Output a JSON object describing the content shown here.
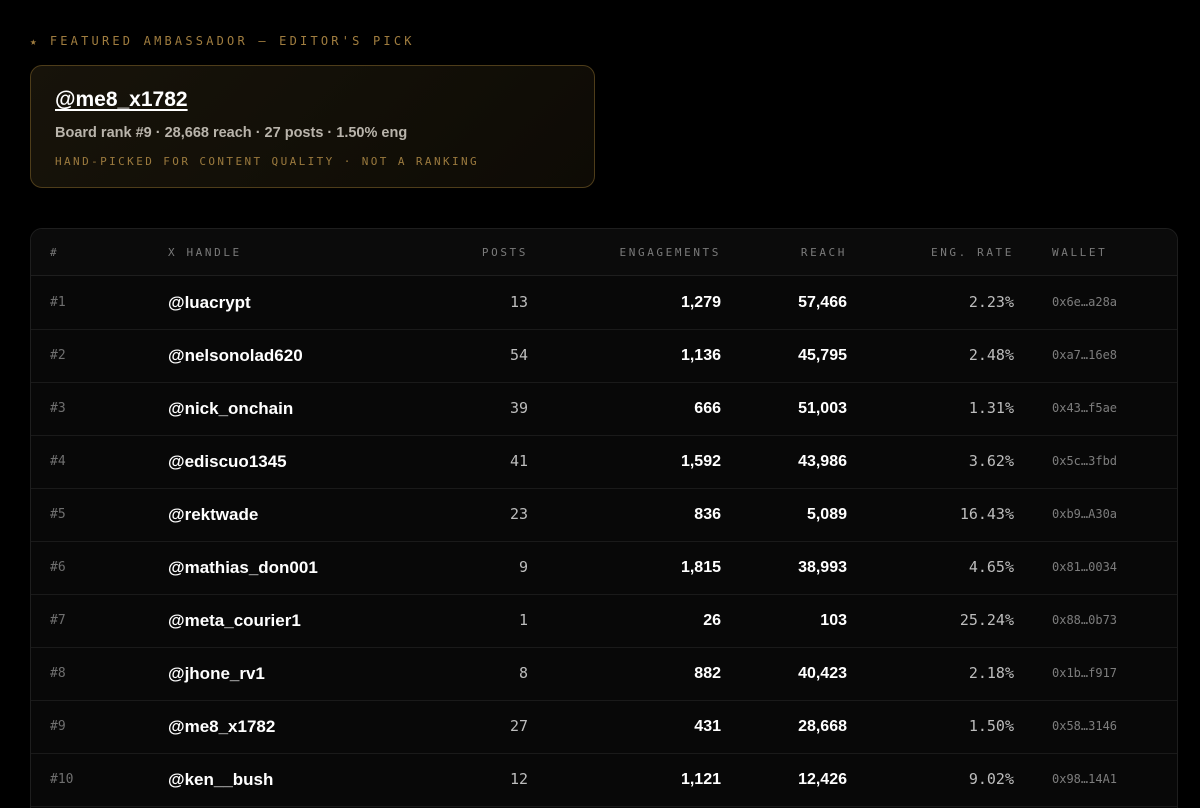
{
  "featured": {
    "star": "★",
    "kicker": "FEATURED AMBASSADOR — EDITOR'S PICK",
    "handle": "@me8_x1782",
    "stats": "Board rank #9 · 28,668 reach · 27 posts · 1.50% eng",
    "note": "HAND-PICKED FOR CONTENT QUALITY · NOT A RANKING"
  },
  "table": {
    "columns": {
      "rank": "#",
      "handle": "X HANDLE",
      "posts": "POSTS",
      "engagements": "ENGAGEMENTS",
      "reach": "REACH",
      "eng_rate": "ENG. RATE",
      "wallet": "WALLET"
    },
    "rows": [
      {
        "rank": "#1",
        "handle": "@luacrypt",
        "posts": "13",
        "engagements": "1,279",
        "reach": "57,466",
        "eng_rate": "2.23%",
        "wallet": "0x6e…a28a"
      },
      {
        "rank": "#2",
        "handle": "@nelsonolad620",
        "posts": "54",
        "engagements": "1,136",
        "reach": "45,795",
        "eng_rate": "2.48%",
        "wallet": "0xa7…16e8"
      },
      {
        "rank": "#3",
        "handle": "@nick_onchain",
        "posts": "39",
        "engagements": "666",
        "reach": "51,003",
        "eng_rate": "1.31%",
        "wallet": "0x43…f5ae"
      },
      {
        "rank": "#4",
        "handle": "@ediscuo1345",
        "posts": "41",
        "engagements": "1,592",
        "reach": "43,986",
        "eng_rate": "3.62%",
        "wallet": "0x5c…3fbd"
      },
      {
        "rank": "#5",
        "handle": "@rektwade",
        "posts": "23",
        "engagements": "836",
        "reach": "5,089",
        "eng_rate": "16.43%",
        "wallet": "0xb9…A30a"
      },
      {
        "rank": "#6",
        "handle": "@mathias_don001",
        "posts": "9",
        "engagements": "1,815",
        "reach": "38,993",
        "eng_rate": "4.65%",
        "wallet": "0x81…0034"
      },
      {
        "rank": "#7",
        "handle": "@meta_courier1",
        "posts": "1",
        "engagements": "26",
        "reach": "103",
        "eng_rate": "25.24%",
        "wallet": "0x88…0b73"
      },
      {
        "rank": "#8",
        "handle": "@jhone_rv1",
        "posts": "8",
        "engagements": "882",
        "reach": "40,423",
        "eng_rate": "2.18%",
        "wallet": "0x1b…f917"
      },
      {
        "rank": "#9",
        "handle": "@me8_x1782",
        "posts": "27",
        "engagements": "431",
        "reach": "28,668",
        "eng_rate": "1.50%",
        "wallet": "0x58…3146"
      },
      {
        "rank": "#10",
        "handle": "@ken__bush",
        "posts": "12",
        "engagements": "1,121",
        "reach": "12,426",
        "eng_rate": "9.02%",
        "wallet": "0x98…14A1"
      }
    ]
  }
}
